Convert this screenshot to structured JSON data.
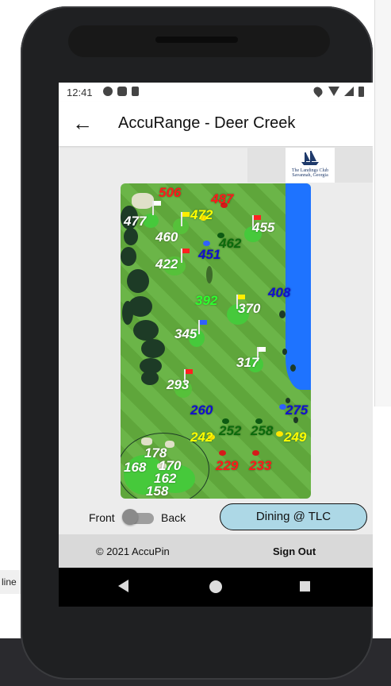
{
  "status_bar": {
    "time": "12:41"
  },
  "app_bar": {
    "title": "AccuRange - Deer Creek",
    "back_icon": "arrow-left-icon"
  },
  "logo": {
    "name": "The Landings Club",
    "location": "Savannah, Georgia"
  },
  "map": {
    "distances": [
      {
        "value": "506",
        "color": "#ff1a1a"
      },
      {
        "value": "487",
        "color": "#ff1a1a"
      },
      {
        "value": "472",
        "color": "#ffff00"
      },
      {
        "value": "477",
        "color": "#ffffff"
      },
      {
        "value": "460",
        "color": "#ffffff"
      },
      {
        "value": "455",
        "color": "#ffffff"
      },
      {
        "value": "462",
        "color": "#0b6b0b"
      },
      {
        "value": "451",
        "color": "#1010d0"
      },
      {
        "value": "422",
        "color": "#ffffff"
      },
      {
        "value": "408",
        "color": "#1010d0"
      },
      {
        "value": "392",
        "color": "#2eff2e"
      },
      {
        "value": "370",
        "color": "#ffffff"
      },
      {
        "value": "345",
        "color": "#ffffff"
      },
      {
        "value": "317",
        "color": "#ffffff"
      },
      {
        "value": "293",
        "color": "#ffffff"
      },
      {
        "value": "260",
        "color": "#1010d0"
      },
      {
        "value": "275",
        "color": "#1010d0"
      },
      {
        "value": "242",
        "color": "#ffff00"
      },
      {
        "value": "252",
        "color": "#0b6b0b"
      },
      {
        "value": "258",
        "color": "#0b6b0b"
      },
      {
        "value": "249",
        "color": "#ffff00"
      },
      {
        "value": "229",
        "color": "#ff1a1a"
      },
      {
        "value": "233",
        "color": "#ff1a1a"
      },
      {
        "value": "178",
        "color": "#ffffff"
      },
      {
        "value": "168",
        "color": "#ffffff"
      },
      {
        "value": "170",
        "color": "#ffffff"
      },
      {
        "value": "162",
        "color": "#ffffff"
      },
      {
        "value": "158",
        "color": "#ffffff"
      }
    ]
  },
  "controls": {
    "front_label": "Front",
    "back_label": "Back",
    "dining_button": "Dining @ TLC"
  },
  "footer": {
    "copyright": "© 2021 AccuPin",
    "sign_out": "Sign Out"
  },
  "outside": {
    "side_label": "line"
  }
}
